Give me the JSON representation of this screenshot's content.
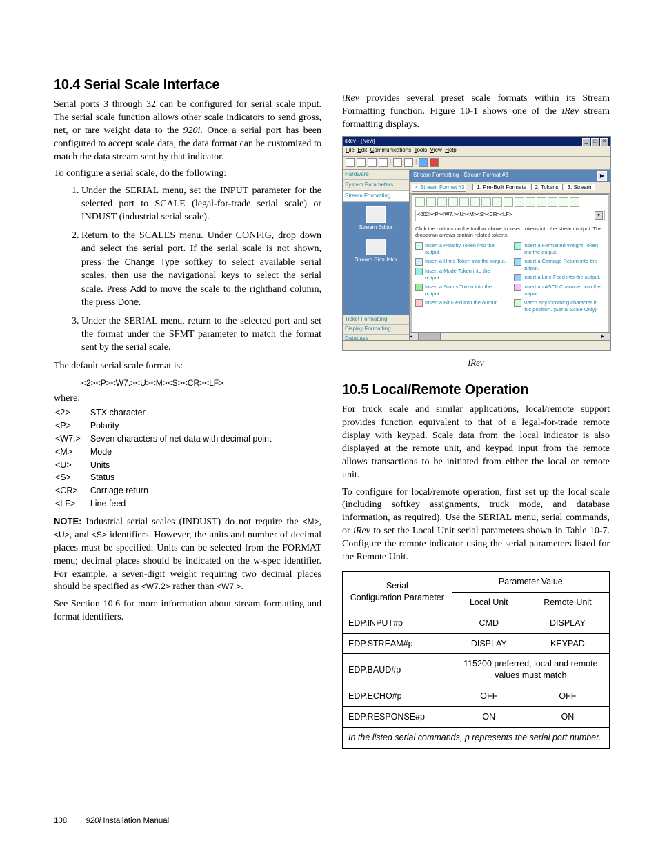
{
  "sec1": {
    "heading": "10.4 Serial Scale Interface",
    "p1": "Serial ports 3 through 32 can be configured for serial scale input. The serial scale function allows other scale indicators to send gross, net, or tare weight data to the 920i. Once a serial port has been configured to accept scale data, the data format can be customized to match the data stream sent by that indicator.",
    "p2": "To configure a serial scale, do the following:",
    "steps": [
      "Under the SERIAL menu, set the INPUT parameter for the selected port to SCALE (legal-for-trade serial scale) or INDUST (industrial serial scale).",
      "Return to the SCALES menu. Under CONFIG, drop down and select the serial port. If the serial scale is not shown, press the Change Type softkey to select available serial scales, then use the navigational keys to select the serial scale. Press Add to move the scale to the righthand column, the press Done.",
      "Under the SERIAL menu, return to the selected port and set the format under the SFMT parameter to match the format sent by the serial scale."
    ],
    "p3": "The default serial scale format is:",
    "fmt": "<2><P><W7.><U><M><S><CR><LF>",
    "where": "where:",
    "defs": [
      [
        "<2>",
        "STX character"
      ],
      [
        "<P>",
        "Polarity"
      ],
      [
        "<W7.>",
        "Seven characters of net data with decimal point"
      ],
      [
        "<M>",
        "Mode"
      ],
      [
        "<U>",
        "Units"
      ],
      [
        "<S>",
        "Status"
      ],
      [
        "<CR>",
        "Carriage return"
      ],
      [
        "<LF>",
        "Line feed"
      ]
    ],
    "note_label": "NOTE:",
    "note_body": " Industrial serial scales (INDUST) do not require the <M>, <U>, and <S> identifiers. However, the units and number of decimal places must be specified. Units can be selected from the FORMAT menu; decimal places should be indicated on the w-spec identifier. For example, a seven-digit weight requiring two decimal places should be specified as <W7.2> rather than <W7.>.",
    "p4": "See Section 10.6 for more information about stream formatting and format identifiers."
  },
  "rightIntro": "iRev provides several preset scale formats within its Stream Formatting function. Figure 10-1 shows one of the iRev stream formatting displays.",
  "figCaption": "iRev",
  "sec2": {
    "heading": "10.5 Local/Remote Operation",
    "p1": "For truck scale and similar applications, local/remote support provides function equivalent to that of a legal-for-trade remote display with keypad. Scale data from the local indicator is also displayed at the remote unit, and keypad input from the remote allows transactions to be initiated from either the local or remote unit.",
    "p2": "To configure for local/remote operation, first set up the local scale (including softkey assignments, truck mode, and database information, as required). Use the SERIAL menu, serial commands, or iRev to set the Local Unit serial parameters shown in Table 10-7. Configure the remote indicator using the serial parameters listed for the Remote Unit."
  },
  "table": {
    "h_param": "Serial",
    "h_param2": "Configuration Parameter",
    "h_value": "Parameter Value",
    "h_local": "Local Unit",
    "h_remote": "Remote Unit",
    "rows": [
      [
        "EDP.INPUT#p",
        "CMD",
        "DISPLAY"
      ],
      [
        "EDP.STREAM#p",
        "DISPLAY",
        "KEYPAD"
      ],
      [
        "EDP.BAUD#p",
        "115200 preferred; local and remote values must match",
        ""
      ],
      [
        "EDP.ECHO#p",
        "OFF",
        "OFF"
      ],
      [
        "EDP.RESPONSE#p",
        "ON",
        "ON"
      ]
    ],
    "footnote": "In the listed serial commands, p represents the serial port number."
  },
  "shot": {
    "title": "iRev - [New]",
    "menu": "File  Edit  Communications  Tools  View  Help",
    "nav": [
      "Hardware",
      "System Parameters",
      "Stream Formatting"
    ],
    "iconLabels": [
      "Stream Editor",
      "Stream Simulator"
    ],
    "bottomNav": [
      "Ticket Formatting",
      "Display Formatting",
      "Database"
    ],
    "panelTitle": "Stream Formatting - Stream Format #3",
    "combo": "Stream Format #3",
    "tabs": [
      "1. Pre-Built Formats",
      "2. Tokens",
      "3. Stream"
    ],
    "fmtline": "<002><P><W7.><U><M><S><CR><LF>",
    "hint": "Click the buttons on the toolbar above to insert tokens into the stream output. The dropdown arrows contain related tokens.",
    "legendL": [
      "Insert a Polarity Token into the output.",
      "Insert a Units Token into the output.",
      "Insert a Mode Token into the output.",
      "Insert a Status Token into the output.",
      "Insert a Bit Field into the output."
    ],
    "legendR": [
      "Insert a Formatted Weight Token into the output.",
      "Insert a Carriage Return into the output.",
      "Insert a Line Feed into the output.",
      "Insert an ASCII Character into the output.",
      "Match any incoming character in this position. (Serial Scale Only)"
    ]
  },
  "footer": {
    "page": "108",
    "doc": "920i",
    "doc2": " Installation Manual"
  }
}
